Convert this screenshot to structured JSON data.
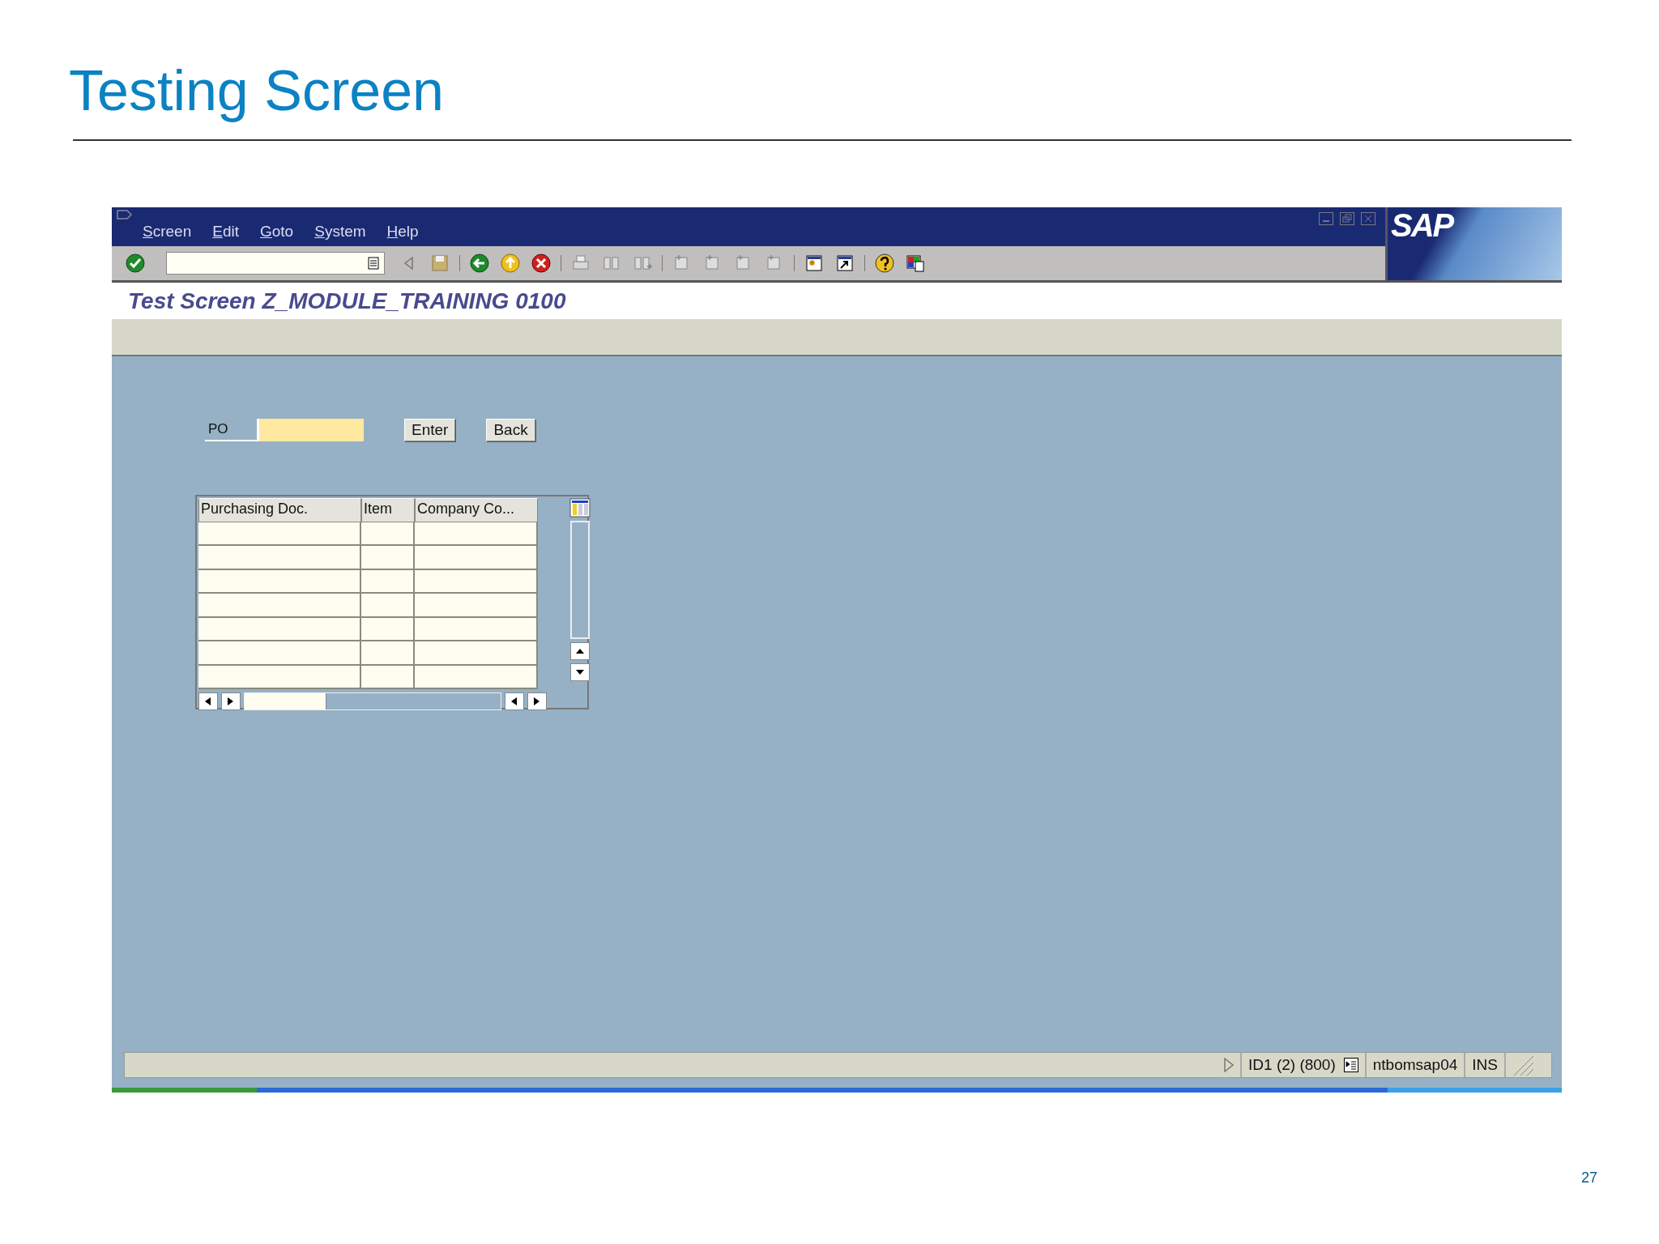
{
  "slide": {
    "title": "Testing Screen",
    "page_number": "27"
  },
  "window": {
    "logo": "SAP",
    "menu": [
      "Screen",
      "Edit",
      "Goto",
      "System",
      "Help"
    ],
    "title": "Test Screen Z_MODULE_TRAINING 0100"
  },
  "form": {
    "label": "PO",
    "buttons": [
      "Enter",
      "Back"
    ]
  },
  "table": {
    "columns": [
      "Purchasing Doc.",
      "Item",
      "Company Co..."
    ]
  },
  "status_bar": {
    "session": "ID1 (2) (800)",
    "server": "ntbomsap04",
    "mode": "INS"
  }
}
